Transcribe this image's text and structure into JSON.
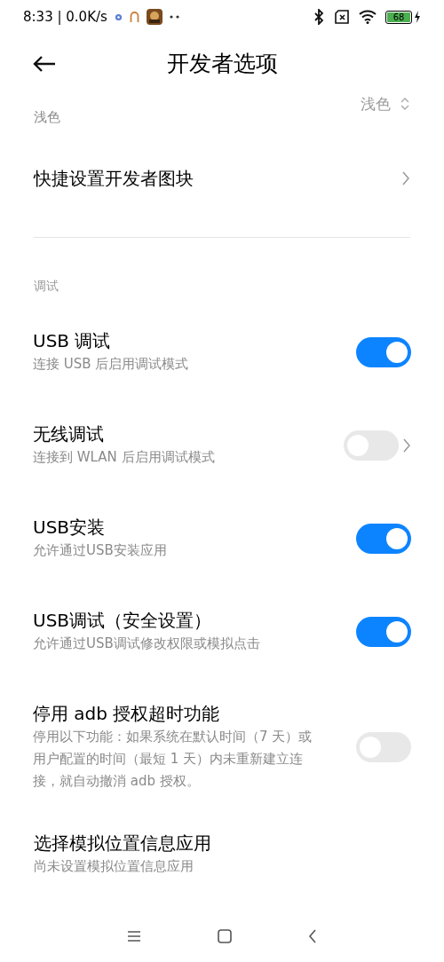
{
  "status_bar": {
    "time": "8:33 | 0.0K/s",
    "battery": "68"
  },
  "header": {
    "title": "开发者选项"
  },
  "items": [
    {
      "kind": "value",
      "subtitle": "浅色",
      "value": "浅色"
    },
    {
      "kind": "link",
      "title": "快捷设置开发者图块"
    },
    {
      "kind": "divider"
    },
    {
      "kind": "section",
      "title": "调试"
    },
    {
      "kind": "switch",
      "title": "USB 调试",
      "subtitle": "连接 USB 后启用调试模式",
      "on": true
    },
    {
      "kind": "switch",
      "title": "无线调试",
      "subtitle": "连接到 WLAN 后启用调试模式",
      "on": false,
      "chevron": true
    },
    {
      "kind": "switch",
      "title": "USB安装",
      "subtitle": "允许通过USB安装应用",
      "on": true
    },
    {
      "kind": "switch",
      "title": "USB调试（安全设置）",
      "subtitle": "允许通过USB调试修改权限或模拟点击",
      "on": true
    },
    {
      "kind": "switch",
      "title": "停用 adb 授权超时功能",
      "subtitle": "停用以下功能：如果系统在默认时间（7 天）或用户配置的时间（最短 1 天）内未重新建立连接，就自动撤消 adb 授权。",
      "on": false
    },
    {
      "kind": "link",
      "title": "选择模拟位置信息应用",
      "subtitle": "尚未设置模拟位置信息应用"
    }
  ]
}
